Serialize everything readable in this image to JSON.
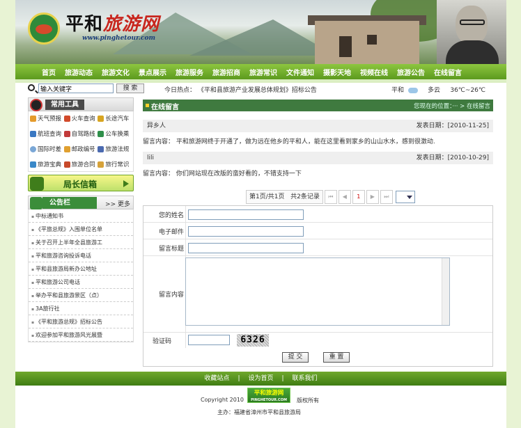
{
  "brand": {
    "name_black": "平和",
    "name_red": "旅游网",
    "url": "www.pinghetour.com"
  },
  "nav": [
    "首页",
    "旅游动态",
    "旅游文化",
    "景点展示",
    "旅游服务",
    "旅游招商",
    "旅游常识",
    "文件通知",
    "摄影天地",
    "视频在线",
    "旅游公告",
    "在线留言"
  ],
  "search": {
    "value": "输入关键字",
    "button": "搜 索"
  },
  "hot": {
    "label": "今日热点：",
    "text": "《平和县旅游产业发展总体规划》招标公告"
  },
  "weather": {
    "city": "平和",
    "cond": "多云",
    "temp": "36℃~26℃"
  },
  "tools": {
    "title": "常用工具",
    "items": [
      "天气预报",
      "火车查询",
      "长途汽车",
      "航班查询",
      "自驾路线",
      "公车换乘",
      "国际时差",
      "邮政编号",
      "旅游法规",
      "旅游宝典",
      "旅游合同",
      "旅行常识"
    ]
  },
  "chief": {
    "title": "局长信箱"
  },
  "notice": {
    "title": "公告栏",
    "more": ">> 更多",
    "items": [
      "中标通知书",
      "《平旅总规》入围单位名单",
      "关于召开上半年全县旅游工",
      "平和旅游咨询投诉电话",
      "平和县旅游局新办公地址",
      "平和旅游公司电话",
      "举办平和县旅游景区（点）",
      "3A旅行社",
      "《平和旅游总规》招标公告",
      "欢迎参加平和旅游风光展暨"
    ]
  },
  "main": {
    "title": "在线留言",
    "crumb": "您现在的位置：··· > 在线留言",
    "messages": [
      {
        "name": "异乡人",
        "date_label": "发表日期：[2010-11-25]",
        "content": "留言内容：   平和旅游网终于开通了，做为远在他乡的平和人，能在这里看到家乡的山山水水，感到很激动."
      },
      {
        "name": "lili",
        "date_label": "发表日期：[2010-10-29]",
        "content": "留言内容：   你们网站现在改版的蛮好看的，不错支持一下"
      }
    ],
    "pager": {
      "info": "第1页/共1页",
      "total": "共2条记录",
      "current": "1"
    },
    "form": {
      "name": "您的姓名",
      "email": "电子邮件",
      "subject": "留言标题",
      "content": "留言内容",
      "code": "验证码",
      "captcha": "6326",
      "submit": "提 交",
      "reset": "重 置"
    }
  },
  "footer": {
    "links": [
      "收藏站点",
      "设为首页",
      "联系我们"
    ],
    "sep": "|",
    "copyright": "Copyright 2010",
    "logo": "平和旅游网",
    "logo_url": "PINGHETOUR.COM",
    "rights": "版权所有",
    "host": "主办：福建省漳州市平和县旅游局"
  }
}
